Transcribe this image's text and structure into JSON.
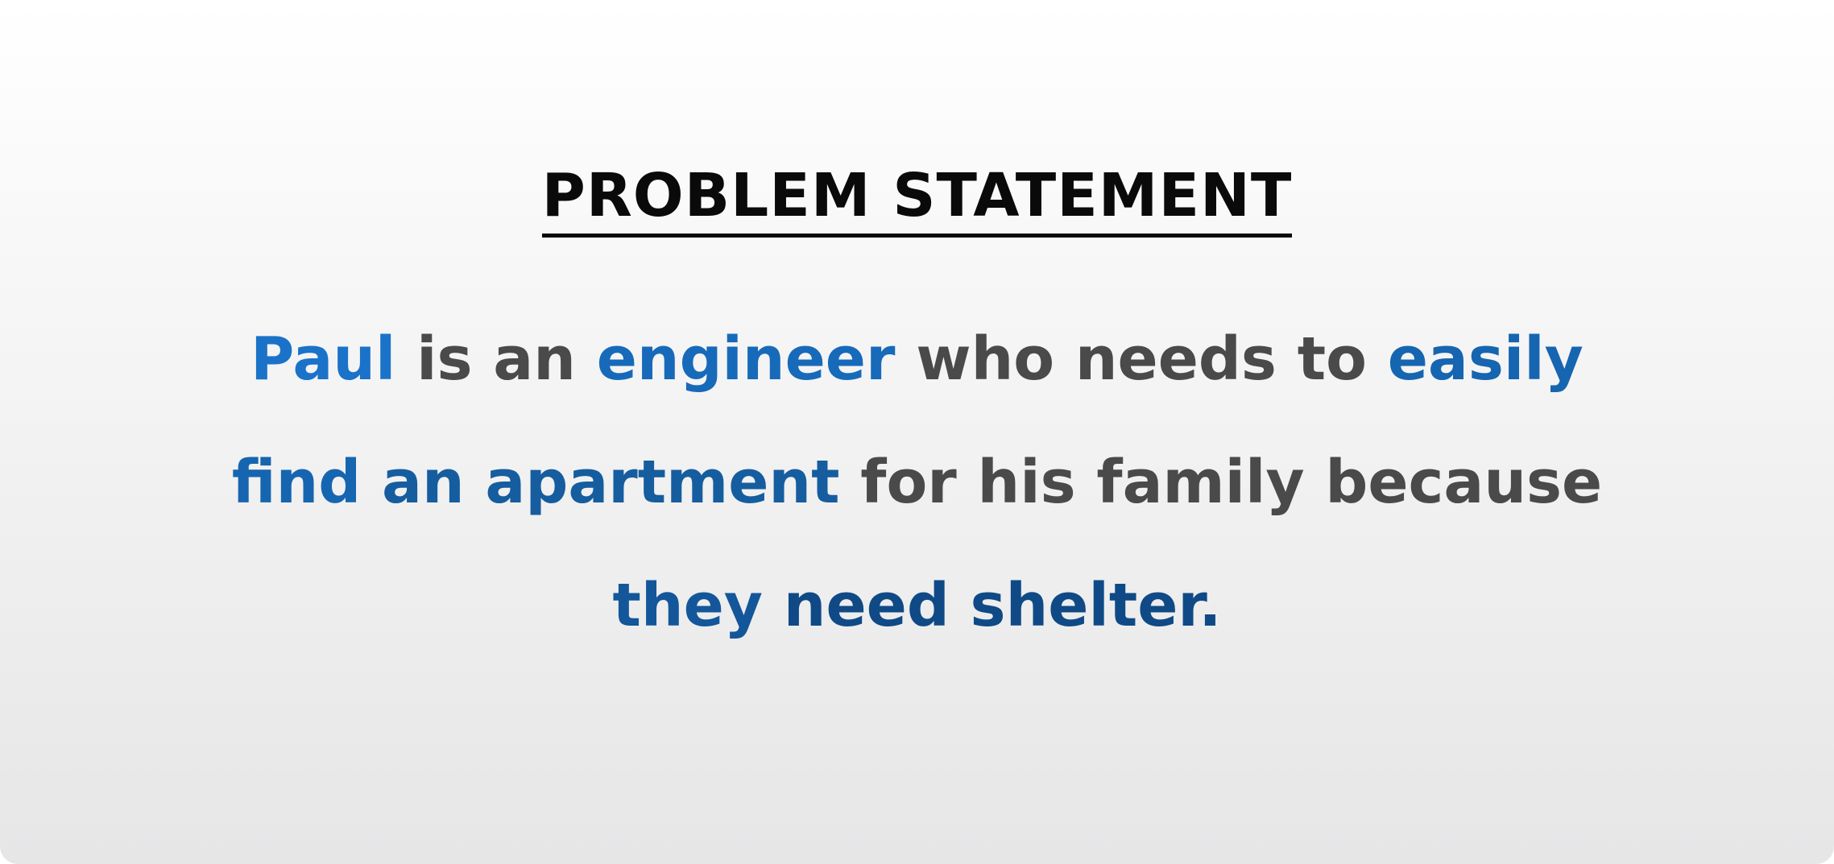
{
  "heading": "PROBLEM STATEMENT",
  "statement": {
    "segments": [
      {
        "text": "Paul",
        "highlight": true,
        "color": "#1a73c8"
      },
      {
        "text": " is an ",
        "highlight": false,
        "color": "#4a4a4a"
      },
      {
        "text": "engineer",
        "highlight": true,
        "color": "#176ab9"
      },
      {
        "text": " who needs to ",
        "highlight": false,
        "color": "#4a4a4a"
      },
      {
        "text": "easily find",
        "highlight": true,
        "color": "#1665b0"
      },
      {
        "text": " ",
        "highlight": false,
        "color": "#4a4a4a"
      },
      {
        "text": "an apartment",
        "highlight": true,
        "color": "#155d9f"
      },
      {
        "text": " for his family because ",
        "highlight": false,
        "color": "#4a4a4a"
      },
      {
        "text": "they",
        "highlight": true,
        "color": "#14569a"
      },
      {
        "text": " ",
        "highlight": false,
        "color": "#4a4a4a"
      },
      {
        "text": "need shelter.",
        "highlight": true,
        "color": "#0f4a86"
      }
    ]
  },
  "colors": {
    "background_top": "#ffffff",
    "background_bottom": "#e6e6e7",
    "heading": "#0a0a0a",
    "body_text": "#4a4a4a",
    "accent_blue": "#1a73c8",
    "accent_blue_dark": "#0f4a86"
  }
}
